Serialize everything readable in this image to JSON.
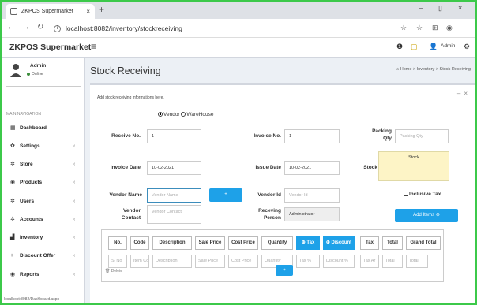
{
  "browser": {
    "tab_title": "ZKPOS Supermarket",
    "tab_close": "×",
    "new_tab": "+",
    "url": "localhost:8082/inventory/stockreceiving",
    "minimize": "–",
    "maximize": "▯",
    "close": "×",
    "back": "←",
    "forward": "→",
    "reload": "↻",
    "extensions": [
      "☆",
      "☆",
      "⊞",
      "◉",
      "⋯"
    ]
  },
  "header": {
    "brand": "ZKPOS Supermarket",
    "menu_toggle": "≡",
    "info_icon": "❶",
    "notif_icon": "▢",
    "user_name": "Admin",
    "settings_icon": "⚙"
  },
  "sidebar": {
    "user": "Admin",
    "status": "Online",
    "nav_header": "MAIN NAVIGATION",
    "items": [
      {
        "label": "Dashboard",
        "icon": "▦",
        "chevron": ""
      },
      {
        "label": "Settings",
        "icon": "✿",
        "chevron": "‹"
      },
      {
        "label": "Store",
        "icon": "✲",
        "chevron": "‹"
      },
      {
        "label": "Products",
        "icon": "◉",
        "chevron": "‹"
      },
      {
        "label": "Users",
        "icon": "✲",
        "chevron": "‹"
      },
      {
        "label": "Accounts",
        "icon": "✲",
        "chevron": "‹"
      },
      {
        "label": "Inventory",
        "icon": "▟",
        "chevron": "‹"
      },
      {
        "label": "Discount Offer",
        "icon": "+",
        "chevron": "‹"
      },
      {
        "label": "Reports",
        "icon": "◉",
        "chevron": "‹"
      }
    ]
  },
  "page": {
    "title": "Stock Receiving",
    "breadcrumb": "⌂ Home  >  Inventory  >  Stock Receiving"
  },
  "form": {
    "box_tools": "–×",
    "subtitle": "Add stock receiving informations here.",
    "radio_vendor": "Vendor",
    "radio_warehouse": "WareHouse",
    "receive_no_label": "Receive No.",
    "receive_no": "1",
    "invoice_no_label": "Invoice No.",
    "invoice_no": "1",
    "packing_qty_label": "Packing Qty",
    "packing_qty_ph": "Packing Qty",
    "invoice_date_label": "Invoice Date",
    "invoice_date": "10-02-2021",
    "issue_date_label": "Issue Date",
    "issue_date": "10-02-2021",
    "stock_label": "Stock",
    "stock_value": "Stock",
    "vendor_name_label": "Vendor Name",
    "vendor_name_ph": "Vendor Name",
    "vendor_add": "+",
    "vendor_id_label": "Vendor Id",
    "vendor_id_ph": "Vendor Id",
    "inclusive_tax": "Inclusive Tax",
    "vendor_contact_label": "Vendor Contact",
    "vendor_contact_ph": "Vendor Contact",
    "receiving_person_label": "Receving Person",
    "receiving_person": "Administrator",
    "add_items": "Add Items ⊕"
  },
  "table": {
    "headers": [
      "No.",
      "Code",
      "Description",
      "Sale Price",
      "Cost Price",
      "Quantity",
      "⊕ Tax",
      "⊕ Discount",
      "Tax",
      "Total",
      "Grand Total"
    ],
    "placeholders": [
      "Sl No",
      "Item Co",
      "Description",
      "Sale Price",
      "Cost Price",
      "Quantity",
      "Tax %",
      "Discount %",
      "Tax Ar",
      "Total",
      "Total",
      ""
    ],
    "delete": "🗑 Delete",
    "add_row": "+"
  },
  "status_url": "localhost:8082/Dashboard.aspx",
  "colors": {
    "accent": "#1ea1e8",
    "frame": "#3cc94a",
    "stock_bg": "#fdf4c6",
    "online": "#3c8d3c"
  }
}
